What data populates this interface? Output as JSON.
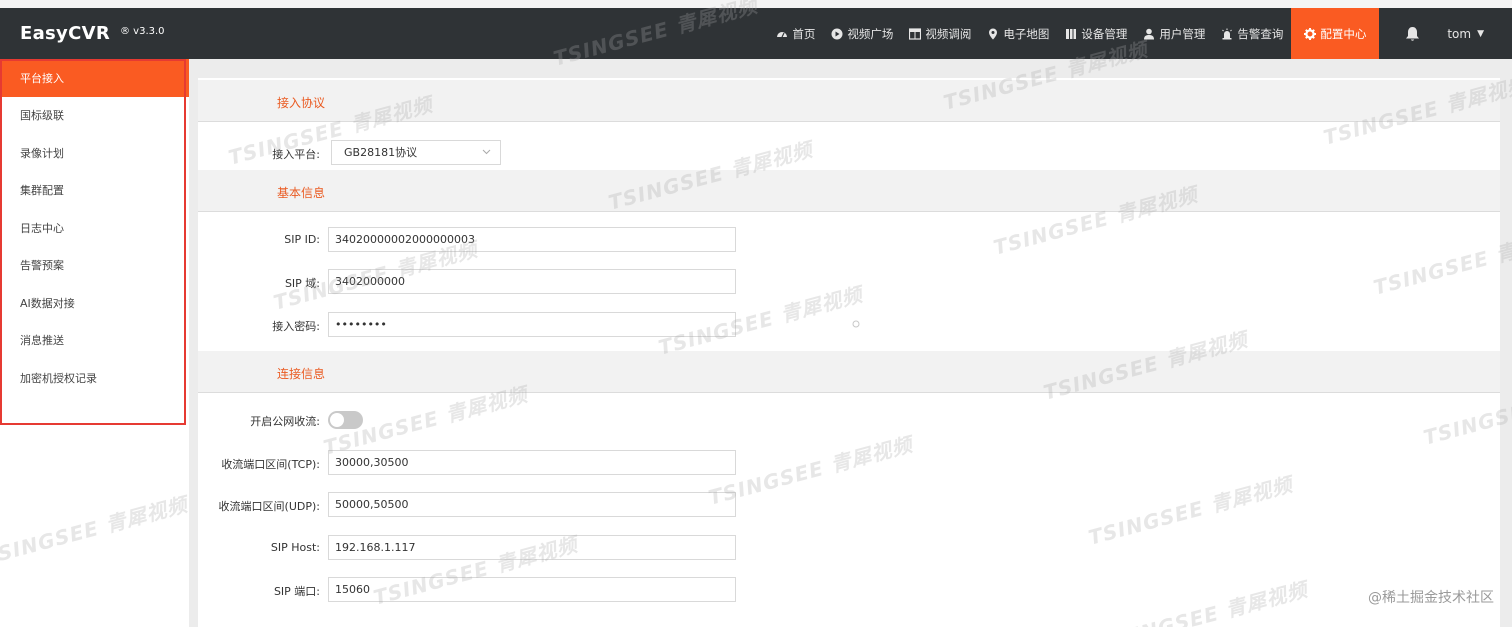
{
  "header": {
    "brand": "EasyCVR",
    "version": "® v3.3.0",
    "nav": [
      {
        "label": "首页",
        "icon": "dashboard-icon",
        "active": false
      },
      {
        "label": "视频广场",
        "icon": "play-circle-icon",
        "active": false
      },
      {
        "label": "视频调阅",
        "icon": "grid-icon",
        "active": false
      },
      {
        "label": "电子地图",
        "icon": "map-pin-icon",
        "active": false
      },
      {
        "label": "设备管理",
        "icon": "device-icon",
        "active": false
      },
      {
        "label": "用户管理",
        "icon": "user-icon",
        "active": false
      },
      {
        "label": "告警查询",
        "icon": "alarm-icon",
        "active": false
      },
      {
        "label": "配置中心",
        "icon": "gear-icon",
        "active": true
      }
    ],
    "user": "tom"
  },
  "sidebar": {
    "items": [
      {
        "label": "平台接入",
        "active": true
      },
      {
        "label": "国标级联",
        "active": false
      },
      {
        "label": "录像计划",
        "active": false
      },
      {
        "label": "集群配置",
        "active": false
      },
      {
        "label": "日志中心",
        "active": false
      },
      {
        "label": "告警预案",
        "active": false
      },
      {
        "label": "AI数据对接",
        "active": false
      },
      {
        "label": "消息推送",
        "active": false
      },
      {
        "label": "加密机授权记录",
        "active": false
      }
    ]
  },
  "main": {
    "sections": {
      "protocol": "接入协议",
      "basic": "基本信息",
      "connection": "连接信息"
    },
    "fields": {
      "platform_label": "接入平台:",
      "platform_value": "GB28181协议",
      "sip_id_label": "SIP ID:",
      "sip_id_value": "34020000002000000003",
      "sip_domain_label": "SIP 域:",
      "sip_domain_value": "3402000000",
      "password_label": "接入密码:",
      "password_value": "••••••••",
      "public_net_label": "开启公网收流:",
      "public_net_enabled": false,
      "tcp_label": "收流端口区间(TCP):",
      "tcp_value": "30000,30500",
      "udp_label": "收流端口区间(UDP):",
      "udp_value": "50000,50500",
      "sip_host_label": "SIP Host:",
      "sip_host_value": "192.168.1.117",
      "sip_port_label": "SIP 端口:",
      "sip_port_value": "15060"
    }
  },
  "watermark": {
    "text": "TSINGSEE 青犀视频",
    "corner": "@稀土掘金技术社区"
  },
  "colors": {
    "accent": "#fa5b22",
    "topbar": "#2f3336",
    "highlight_border": "#e63a32"
  }
}
